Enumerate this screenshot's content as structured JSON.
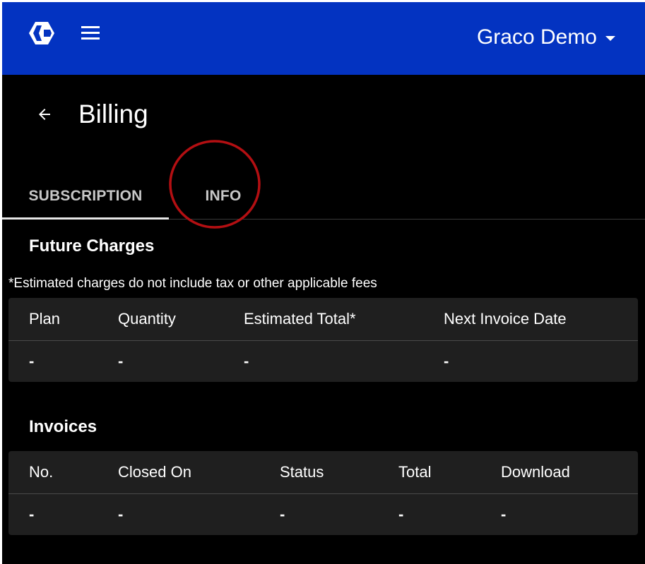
{
  "header": {
    "account_name": "Graco Demo"
  },
  "page": {
    "title": "Billing"
  },
  "tabs": [
    {
      "label": "SUBSCRIPTION",
      "selected": true
    },
    {
      "label": "INFO",
      "selected": false
    }
  ],
  "future_charges": {
    "title": "Future Charges",
    "note": "*Estimated charges do not include tax or other applicable fees",
    "columns": [
      "Plan",
      "Quantity",
      "Estimated Total*",
      "Next Invoice Date"
    ],
    "rows": [
      [
        "-",
        "-",
        "-",
        "-"
      ]
    ]
  },
  "invoices": {
    "title": "Invoices",
    "columns": [
      "No.",
      "Closed On",
      "Status",
      "Total",
      "Download"
    ],
    "rows": [
      [
        "-",
        "-",
        "-",
        "-",
        "-"
      ]
    ]
  },
  "colors": {
    "appbar": "#0333c1",
    "background": "#000000",
    "table_bg": "#1f1f1f",
    "annotation": "#b30f12"
  },
  "icons": {
    "logo": "graco-logo-icon",
    "menu": "hamburger-menu-icon",
    "account_dropdown": "caret-down-icon",
    "back": "arrow-left-icon"
  }
}
